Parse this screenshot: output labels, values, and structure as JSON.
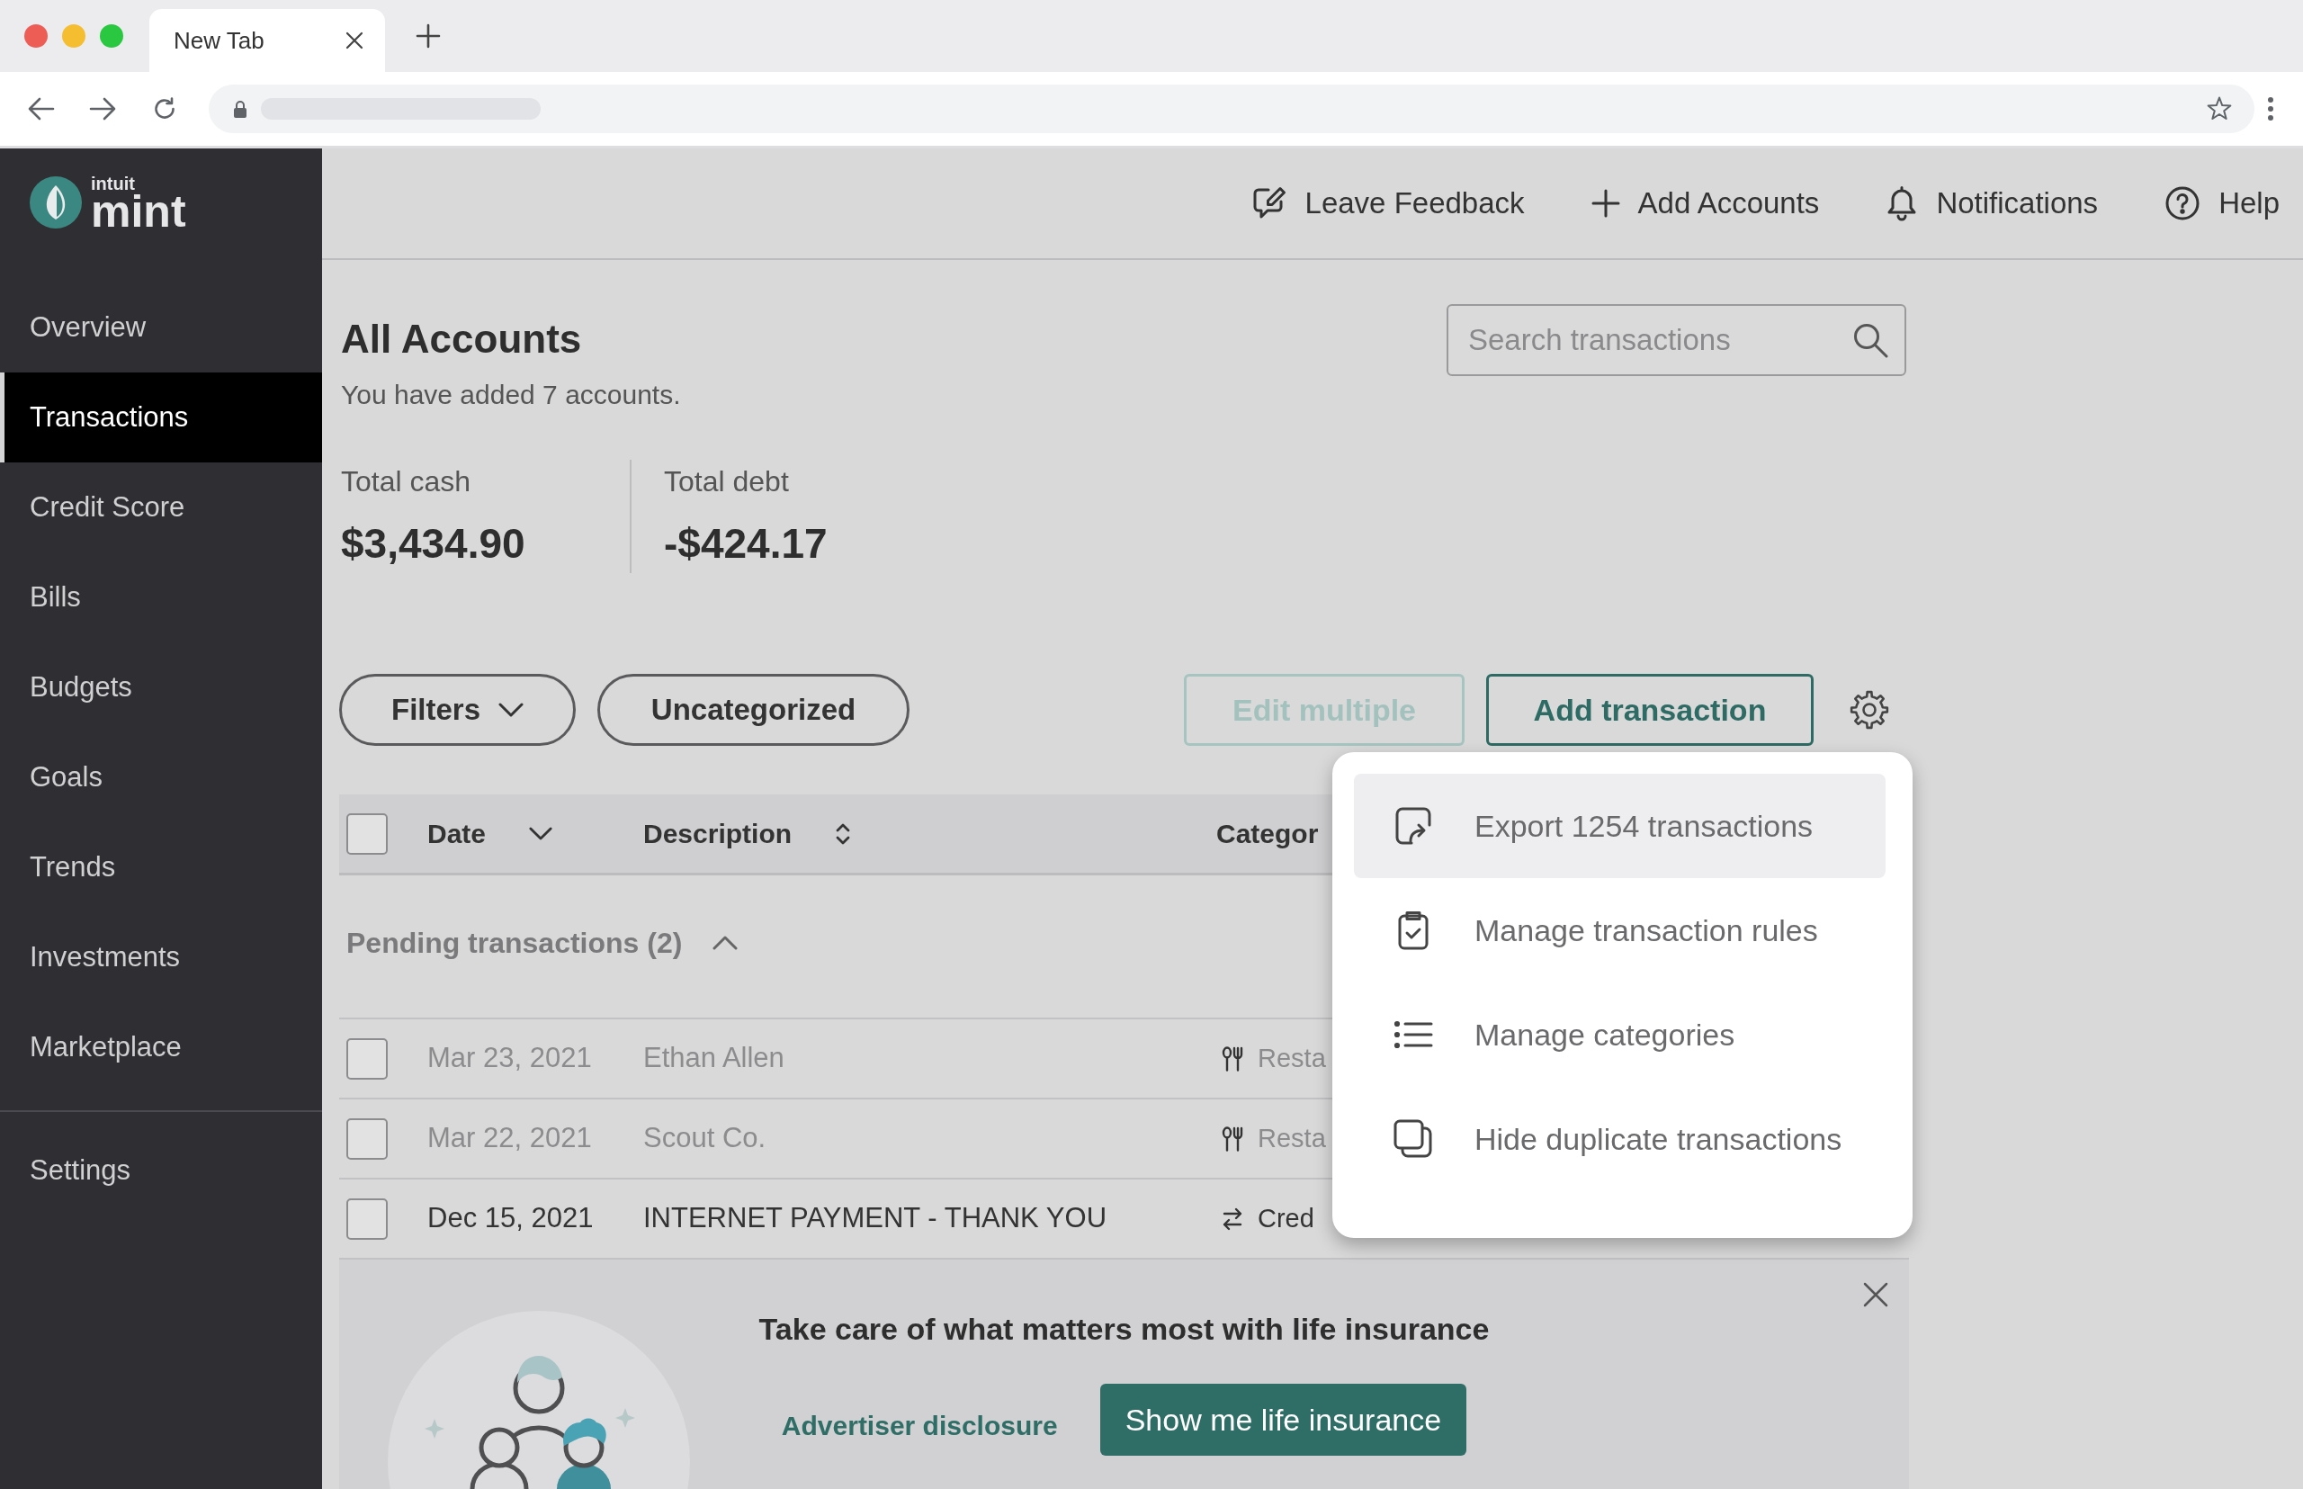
{
  "browser": {
    "tab": {
      "title": "New Tab"
    }
  },
  "logo": {
    "brand": "intuit",
    "product": "mint"
  },
  "sidebar": {
    "items": [
      {
        "label": "Overview",
        "selected": false
      },
      {
        "label": "Transactions",
        "selected": true
      },
      {
        "label": "Credit Score",
        "selected": false
      },
      {
        "label": "Bills",
        "selected": false
      },
      {
        "label": "Budgets",
        "selected": false
      },
      {
        "label": "Goals",
        "selected": false
      },
      {
        "label": "Trends",
        "selected": false
      },
      {
        "label": "Investments",
        "selected": false
      },
      {
        "label": "Marketplace",
        "selected": false
      }
    ],
    "footer_items": [
      {
        "label": "Settings",
        "selected": false
      }
    ]
  },
  "header": {
    "actions": [
      {
        "kind": "feedback",
        "label": "Leave Feedback"
      },
      {
        "kind": "add",
        "label": "Add Accounts"
      },
      {
        "kind": "notifications",
        "label": "Notifications"
      },
      {
        "kind": "help",
        "label": "Help"
      }
    ]
  },
  "page": {
    "title": "All Accounts",
    "subtitle": "You have added 7 accounts."
  },
  "search": {
    "placeholder": "Search transactions"
  },
  "totals": [
    {
      "label": "Total cash",
      "value": "$3,434.90"
    },
    {
      "label": "Total debt",
      "value": "-$424.17"
    }
  ],
  "toolbar": {
    "filters": [
      {
        "kind": "dropdown",
        "label": "Filters"
      },
      {
        "kind": "chip",
        "label": "Uncategorized"
      }
    ],
    "buttons": [
      {
        "label": "Edit multiple",
        "disabled": true
      },
      {
        "label": "Add transaction",
        "disabled": false
      }
    ]
  },
  "settings_menu": {
    "items": [
      {
        "kind": "export",
        "label": "Export 1254 transactions",
        "selected": true
      },
      {
        "kind": "rules",
        "label": "Manage transaction rules",
        "selected": false
      },
      {
        "kind": "categories",
        "label": "Manage categories",
        "selected": false
      },
      {
        "kind": "duplicates",
        "label": "Hide duplicate transactions",
        "selected": false
      }
    ]
  },
  "table": {
    "checked": false,
    "columns": [
      {
        "label": "Date",
        "kind": "descending"
      },
      {
        "label": "Description",
        "kind": "unsorted"
      },
      {
        "label": "Categor",
        "kind": "plain"
      }
    ],
    "groups": [
      {
        "label": "Pending transactions (2)",
        "expanded": true
      }
    ],
    "rows": [
      {
        "checked": false,
        "date": "Mar 23, 2021",
        "description": "Ethan Allen",
        "category": {
          "kind": "restaurant",
          "label": "Resta"
        },
        "pending": true
      },
      {
        "checked": false,
        "date": "Mar 22, 2021",
        "description": "Scout Co.",
        "category": {
          "kind": "restaurant",
          "label": "Resta"
        },
        "pending": true
      },
      {
        "checked": false,
        "date": "Dec 15, 2021",
        "description": "INTERNET PAYMENT - THANK YOU",
        "category": {
          "kind": "transfer",
          "label": "Cred"
        },
        "pending": false
      }
    ]
  },
  "banner": {
    "title": "Take care of what matters most with life insurance",
    "link": "Advertiser disclosure",
    "button": "Show me life insurance"
  }
}
